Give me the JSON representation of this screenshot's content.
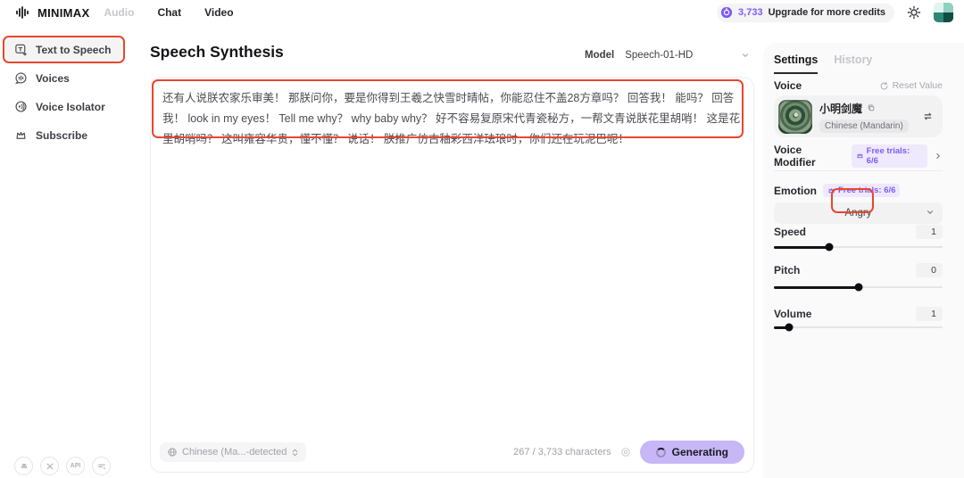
{
  "header": {
    "brand": "MINIMAX",
    "nav": [
      {
        "label": "Audio"
      },
      {
        "label": "Chat"
      },
      {
        "label": "Video"
      }
    ],
    "credits": "3,733",
    "upgrade_label": "Upgrade for more credits"
  },
  "sidebar": {
    "items": [
      {
        "label": "Text to Speech"
      },
      {
        "label": "Voices"
      },
      {
        "label": "Voice Isolator"
      },
      {
        "label": "Subscribe"
      }
    ],
    "api_label": "API"
  },
  "main": {
    "title": "Speech Synthesis",
    "model_label": "Model",
    "model_value": "Speech-01-HD",
    "editor_text": "还有人说朕农家乐审美！ 那朕问你，要是你得到王羲之快雪时晴帖，你能忍住不盖28方章吗？ 回答我！ 能吗？ 回答我！ look in my eyes！ Tell me why？ why baby why？ 好不容易复原宋代青瓷秘方，一帮文青说朕花里胡哨！ 这是花里胡哨吗？ 这叫雍容华贵，懂不懂？ 说话！ 朕推广仿古釉彩西洋珐琅时，你们还在玩泥巴呢！",
    "language_value": "Chinese (Ma...-detected",
    "char_count": "267 / 3,733 characters",
    "generate_label": "Generating"
  },
  "settings_panel": {
    "tab_settings": "Settings",
    "tab_history": "History",
    "voice_label": "Voice",
    "reset_label": "Reset Value",
    "voice_name": "小明剑魔",
    "voice_language": "Chinese (Mandarin)",
    "voice_modifier_label": "Voice Modifier",
    "voice_modifier_trials": "Free trials: 6/6",
    "emotion_label": "Emotion",
    "emotion_trials": "Free trials: 6/6",
    "emotion_value": "Angry",
    "sliders": [
      {
        "label": "Speed",
        "value": "1",
        "percent": 33
      },
      {
        "label": "Pitch",
        "value": "0",
        "percent": 50
      },
      {
        "label": "Volume",
        "value": "1",
        "percent": 9
      }
    ]
  },
  "colors": {
    "accent_purple": "#7c5cf6",
    "annotation_red": "#e8462d",
    "generate_button_bg": "#c7b7f6"
  }
}
